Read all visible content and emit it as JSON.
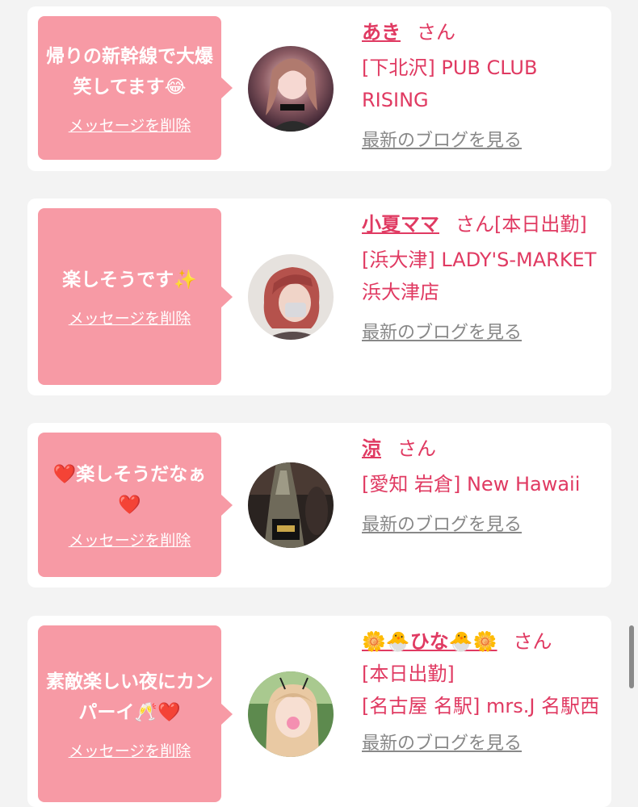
{
  "colors": {
    "bubble": "#f79aa5",
    "accent": "#e03a62",
    "link_gray": "#888888",
    "background": "#f3f3f3"
  },
  "cards": [
    {
      "message": "帰りの新幹線で大爆笑してます😂",
      "delete_label": "メッセージを削除",
      "name": "あき",
      "honorific": "さん",
      "shop": "[下北沢] PUB CLUB RISING",
      "blog_label": "最新のブログを見る",
      "avatar": "avatar-photo"
    },
    {
      "message": "楽しそうです✨",
      "delete_label": "メッセージを削除",
      "name": "小夏ママ",
      "honorific": "さん[本日出勤]",
      "shop": "[浜大津] LADY'S-MARKET 浜大津店",
      "blog_label": "最新のブログを見る",
      "avatar": "avatar-photo"
    },
    {
      "message": "❤️楽しそうだなぁ❤️",
      "delete_label": "メッセージを削除",
      "name": "涼",
      "honorific": "さん",
      "shop": "[愛知 岩倉] New Hawaii",
      "blog_label": "最新のブログを見る",
      "avatar": "avatar-photo"
    },
    {
      "message": "素敵楽しい夜にカンパーイ🥂❤️",
      "delete_label": "メッセージを削除",
      "name": "🌼🐣ひな🐣🌼",
      "honorific": "さん",
      "status": "[本日出勤]",
      "shop": "[名古屋 名駅] mrs.J 名駅西",
      "blog_label": "最新のブログを見る",
      "avatar": "avatar-photo"
    }
  ]
}
